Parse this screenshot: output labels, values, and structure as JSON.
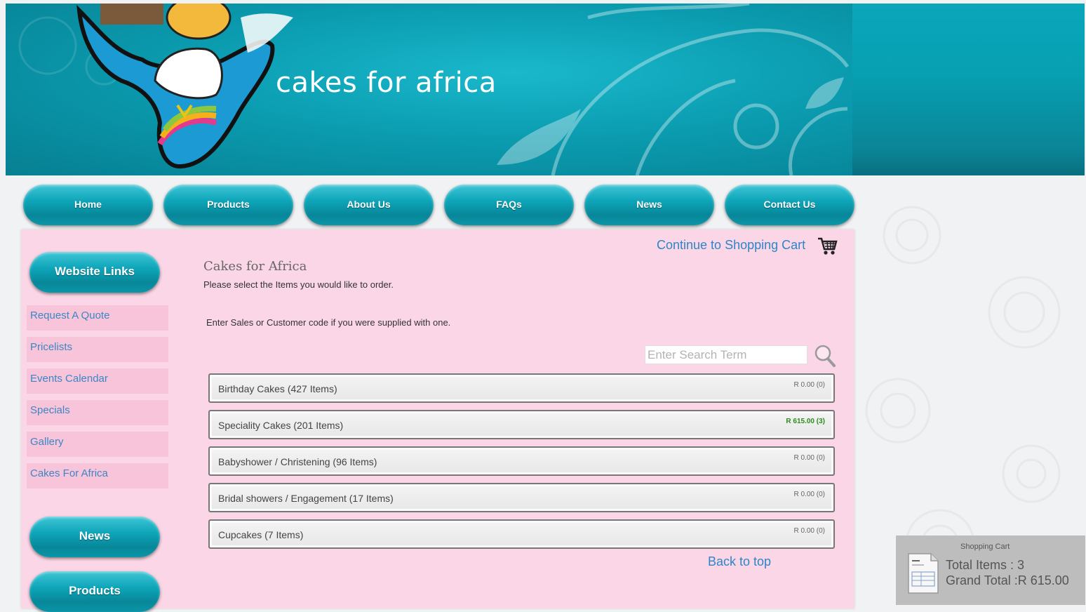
{
  "site": {
    "title": "cakes for africa"
  },
  "nav": [
    {
      "label": "Home"
    },
    {
      "label": "Products"
    },
    {
      "label": "About Us"
    },
    {
      "label": "FAQs"
    },
    {
      "label": "News"
    },
    {
      "label": "Contact Us"
    }
  ],
  "sidebar": {
    "heading": "Website Links",
    "links": [
      {
        "label": "Request A Quote"
      },
      {
        "label": "Pricelists"
      },
      {
        "label": "Events Calendar"
      },
      {
        "label": "Specials"
      },
      {
        "label": "Gallery"
      },
      {
        "label": "Cakes For Africa"
      }
    ],
    "news_button": "News",
    "products_button": "Products"
  },
  "main": {
    "continue_link": "Continue to Shopping Cart",
    "title": "Cakes for Africa",
    "subtitle": "Please select the Items you would like to order.",
    "code_note": "Enter Sales or Customer code if you were supplied with one.",
    "search_placeholder": "Enter Search Term",
    "categories": [
      {
        "name": "Birthday Cakes (427 Items)",
        "total": "R 0.00 (0)"
      },
      {
        "name": "Speciality Cakes (201 Items)",
        "total": "R 615.00 (3)"
      },
      {
        "name": "Babyshower / Christening (96 Items)",
        "total": "R 0.00 (0)"
      },
      {
        "name": "Bridal showers / Engagement (17 Items)",
        "total": "R 0.00 (0)"
      },
      {
        "name": "Cupcakes (7 Items)",
        "total": "R 0.00 (0)"
      }
    ],
    "back_to_top": "Back to top"
  },
  "cart_widget": {
    "title": "Shopping Cart",
    "total_items": "Total Items : 3",
    "grand_total": "Grand Total :R 615.00"
  },
  "colors": {
    "brand_teal": "#0ea5b9",
    "panel_pink": "#fbd6e6",
    "link_blue": "#2c86c8",
    "active_total_green": "#2e8b1f"
  }
}
